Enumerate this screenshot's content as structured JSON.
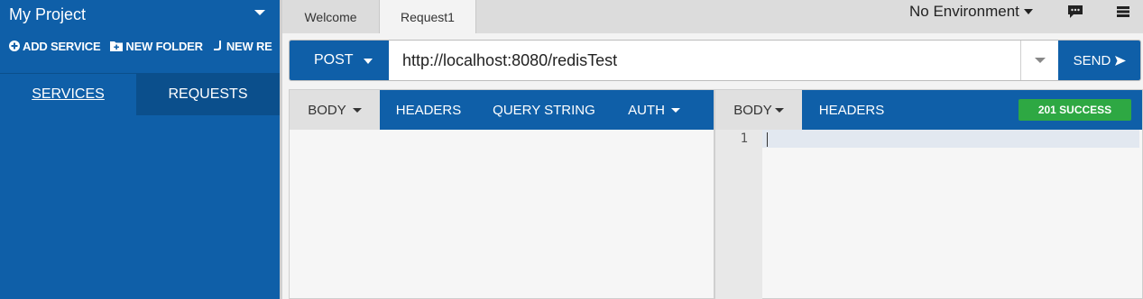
{
  "sidebar": {
    "project_title": "My Project",
    "actions": [
      {
        "label": "ADD SERVICE",
        "icon": "plus-circle-icon"
      },
      {
        "label": "NEW FOLDER",
        "icon": "folder-plus-icon"
      },
      {
        "label": "NEW RE",
        "icon": "new-request-icon"
      }
    ],
    "tabs": [
      {
        "label": "SERVICES",
        "active": true
      },
      {
        "label": "REQUESTS",
        "active": false
      }
    ]
  },
  "topbar": {
    "tabs": [
      {
        "label": "Welcome",
        "active": false
      },
      {
        "label": "Request1",
        "active": true
      }
    ],
    "environment": "No Environment",
    "icons": [
      "chat-icon",
      "menu-icon"
    ]
  },
  "request": {
    "method": "POST",
    "url": "http://localhost:8080/redisTest",
    "send_label": "SEND",
    "tabs": [
      {
        "label": "BODY",
        "dropdown": true,
        "selected": true
      },
      {
        "label": "HEADERS",
        "dropdown": false,
        "selected": false
      },
      {
        "label": "QUERY STRING",
        "dropdown": false,
        "selected": false
      },
      {
        "label": "AUTH",
        "dropdown": true,
        "selected": false
      }
    ]
  },
  "response": {
    "tabs": [
      {
        "label": "BODY",
        "dropdown": true,
        "selected": true
      },
      {
        "label": "HEADERS",
        "dropdown": false,
        "selected": false
      }
    ],
    "status": "201 SUCCESS",
    "line_numbers": [
      "1"
    ]
  },
  "colors": {
    "primary": "#0f5fa8",
    "primary_dark": "#0b4f8c",
    "success": "#2ea843"
  }
}
